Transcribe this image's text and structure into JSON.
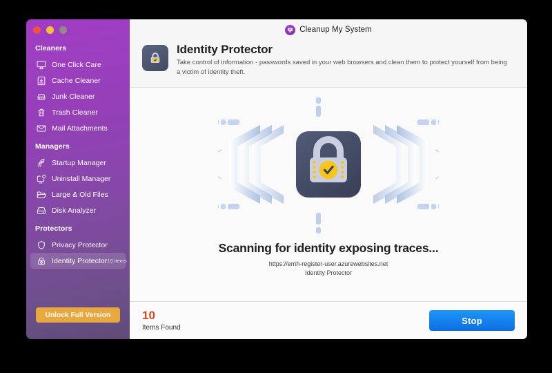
{
  "window": {
    "traffic_lights": [
      {
        "name": "close",
        "color": "#f0523f"
      },
      {
        "name": "minimize",
        "color": "#f5c033"
      },
      {
        "name": "zoom",
        "color": "#8f8c85"
      }
    ]
  },
  "app": {
    "title": "Cleanup My System",
    "logo_icon": "monitor-circle-icon"
  },
  "sidebar": {
    "groups": [
      {
        "title": "Cleaners",
        "items": [
          {
            "label": "One Click Care",
            "icon": "monitor-icon",
            "selected": false,
            "badge": ""
          },
          {
            "label": "Cache Cleaner",
            "icon": "cache-icon",
            "selected": false,
            "badge": ""
          },
          {
            "label": "Junk Cleaner",
            "icon": "broom-icon",
            "selected": false,
            "badge": ""
          },
          {
            "label": "Trash Cleaner",
            "icon": "trash-icon",
            "selected": false,
            "badge": ""
          },
          {
            "label": "Mail Attachments",
            "icon": "envelope-icon",
            "selected": false,
            "badge": ""
          }
        ]
      },
      {
        "title": "Managers",
        "items": [
          {
            "label": "Startup Manager",
            "icon": "rocket-icon",
            "selected": false,
            "badge": ""
          },
          {
            "label": "Uninstall Manager",
            "icon": "uninstall-icon",
            "selected": false,
            "badge": ""
          },
          {
            "label": "Large & Old Files",
            "icon": "folder-icon",
            "selected": false,
            "badge": ""
          },
          {
            "label": "Disk Analyzer",
            "icon": "disk-icon",
            "selected": false,
            "badge": ""
          }
        ]
      },
      {
        "title": "Protectors",
        "items": [
          {
            "label": "Privacy Protector",
            "icon": "shield-icon",
            "selected": false,
            "badge": ""
          },
          {
            "label": "Identity Protector",
            "icon": "lock-icon",
            "selected": true,
            "badge": "10 items"
          }
        ]
      }
    ],
    "unlock_button": "Unlock Full Version",
    "accent_color": "#e9a73f"
  },
  "page": {
    "icon": "lock-badge-icon",
    "title": "Identity Protector",
    "subtitle": "Take control of information - passwords saved in your web browsers and clean them to protect yourself from being a victim of identity theft."
  },
  "scan": {
    "hero_icon": "lock-shield-hero-icon",
    "status_title": "Scanning for identity exposing traces...",
    "current_url": "https://emh-register-user.azurewebsites.net",
    "module_name": "Identity Protector"
  },
  "footer": {
    "count": "10",
    "count_label": "Items Found",
    "count_color": "#d34a22",
    "stop_button": "Stop",
    "stop_button_color": "#0b6fe3"
  }
}
